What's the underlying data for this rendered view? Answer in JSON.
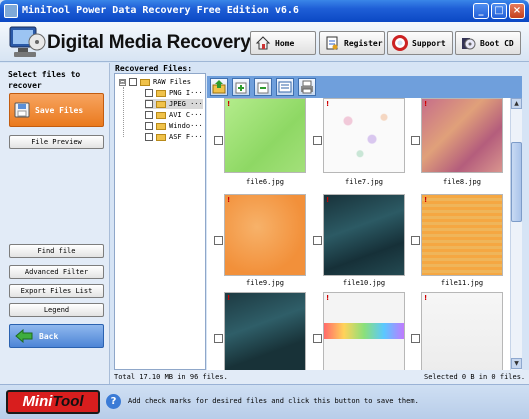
{
  "window": {
    "title": "MiniTool Power Data Recovery Free Edition v6.6",
    "controls": [
      "_",
      "□",
      "×"
    ]
  },
  "header": {
    "app_title": "Digital Media Recovery",
    "nav": [
      {
        "label": "Home",
        "icon": "house-icon"
      },
      {
        "label": "Register",
        "icon": "register-icon"
      },
      {
        "label": "Support",
        "icon": "lifebuoy-icon"
      },
      {
        "label": "Boot CD",
        "icon": "cd-icon"
      }
    ]
  },
  "sidebar": {
    "prompt": "Select files to recover",
    "save_label": "Save Files",
    "preview_label": "File Preview",
    "find_label": "Find file",
    "filter_label": "Advanced Filter",
    "export_label": "Export Files List",
    "legend_label": "Legend",
    "back_label": "Back"
  },
  "main": {
    "recovered_label": "Recovered Files:",
    "tree": [
      {
        "label": "RAW Files",
        "expander": "⊟"
      },
      {
        "label": "PNG I···"
      },
      {
        "label": "JPEG ···"
      },
      {
        "label": "AVI C···"
      },
      {
        "label": "Windo···"
      },
      {
        "label": "ASF F···"
      }
    ],
    "toolbar_icons": [
      "up-folder-icon",
      "add-icon",
      "remove-icon",
      "view-icon",
      "print-icon"
    ],
    "files": [
      {
        "name": "file6.jpg"
      },
      {
        "name": "file7.jpg"
      },
      {
        "name": "file8.jpg"
      },
      {
        "name": "file9.jpg"
      },
      {
        "name": "file10.jpg"
      },
      {
        "name": "file11.jpg"
      },
      {
        "name": ""
      },
      {
        "name": ""
      },
      {
        "name": ""
      }
    ],
    "flag_mark": "!"
  },
  "status": {
    "total": "Total 17.10 MB in 96 files.",
    "selected": "Selected 0 B in 0 files."
  },
  "footer": {
    "logo_mini": "Mini",
    "logo_tool": "Tool",
    "help_glyph": "?",
    "hint": "Add check marks for desired files and click this button to save them."
  },
  "colors": {
    "accent_orange": "#ea7a1e",
    "titlebar_blue": "#0b48c4",
    "brand_red": "#d81e1e"
  }
}
